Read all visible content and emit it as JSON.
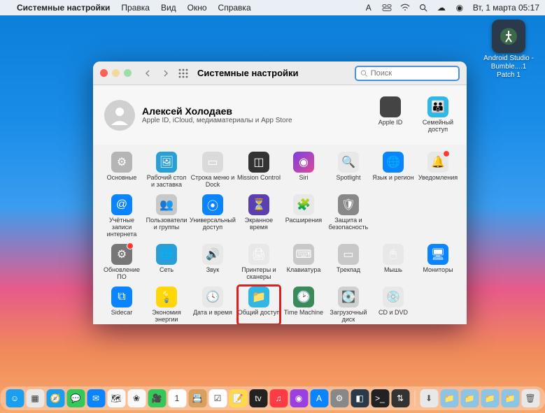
{
  "menubar": {
    "apple": "",
    "appname": "Системные настройки",
    "items": [
      "Правка",
      "Вид",
      "Окно",
      "Справка"
    ],
    "clock": "Вт, 1 марта  05:17"
  },
  "desktop_icon": {
    "label": "Android Studio - Bumble....1 Patch 1"
  },
  "window": {
    "title": "Системные настройки",
    "search_placeholder": "Поиск",
    "user": {
      "name": "Алексей Холодаев",
      "subtitle": "Apple ID, iCloud, медиаматериалы и App Store"
    },
    "right_items": [
      {
        "label": "Apple ID",
        "name": "apple-id",
        "color": "#444"
      },
      {
        "label": "Семейный доступ",
        "name": "family-sharing",
        "color": "#2fb8e6"
      }
    ],
    "prefs": [
      {
        "label": "Основные",
        "name": "general",
        "bg": "#b5b5b5",
        "glyph": "⚙"
      },
      {
        "label": "Рабочий стол и заставка",
        "name": "desktop-screensaver",
        "bg": "#2a9fd6",
        "glyph": "🖼"
      },
      {
        "label": "Строка меню и Dock",
        "name": "dock-menubar",
        "bg": "#dadada",
        "glyph": "▭"
      },
      {
        "label": "Mission Control",
        "name": "mission-control",
        "bg": "#333",
        "glyph": "◫"
      },
      {
        "label": "Siri",
        "name": "siri",
        "bg": "linear-gradient(135deg,#7a3fe0,#e04a9a)",
        "glyph": "◉"
      },
      {
        "label": "Spotlight",
        "name": "spotlight",
        "bg": "#e8e8e8",
        "glyph": "🔍"
      },
      {
        "label": "Язык и регион",
        "name": "language-region",
        "bg": "#0a84ff",
        "glyph": "🌐"
      },
      {
        "label": "Уведомления",
        "name": "notifications",
        "bg": "#e8e8e8",
        "glyph": "🔔",
        "badge": true
      },
      {
        "label": "Учётные записи интернета",
        "name": "internet-accounts",
        "bg": "#0a84ff",
        "glyph": "@"
      },
      {
        "label": "Пользователи и группы",
        "name": "users-groups",
        "bg": "#c8c8c8",
        "glyph": "👥"
      },
      {
        "label": "Универсальный доступ",
        "name": "accessibility",
        "bg": "#0a84ff",
        "glyph": "⦿"
      },
      {
        "label": "Экранное время",
        "name": "screen-time",
        "bg": "#5a3fb0",
        "glyph": "⏳"
      },
      {
        "label": "Расширения",
        "name": "extensions",
        "bg": "#e8e8e8",
        "glyph": "🧩"
      },
      {
        "label": "Защита и безопасность",
        "name": "security-privacy",
        "bg": "#888",
        "glyph": "🛡"
      },
      {
        "label": "",
        "name": "empty1",
        "bg": "transparent"
      },
      {
        "label": "",
        "name": "empty2",
        "bg": "transparent"
      },
      {
        "label": "Обновление ПО",
        "name": "software-update",
        "bg": "#777",
        "glyph": "⚙",
        "badge": true
      },
      {
        "label": "Сеть",
        "name": "network",
        "bg": "#2a9fd6",
        "glyph": "🌐"
      },
      {
        "label": "Звук",
        "name": "sound",
        "bg": "#e8e8e8",
        "glyph": "🔊"
      },
      {
        "label": "Принтеры и сканеры",
        "name": "printers-scanners",
        "bg": "#e8e8e8",
        "glyph": "🖨"
      },
      {
        "label": "Клавиатура",
        "name": "keyboard",
        "bg": "#c8c8c8",
        "glyph": "⌨"
      },
      {
        "label": "Трекпад",
        "name": "trackpad",
        "bg": "#c8c8c8",
        "glyph": "▭"
      },
      {
        "label": "Мышь",
        "name": "mouse",
        "bg": "#e8e8e8",
        "glyph": "🖱"
      },
      {
        "label": "Мониторы",
        "name": "displays",
        "bg": "#0a84ff",
        "glyph": "🖥"
      },
      {
        "label": "Sidecar",
        "name": "sidecar",
        "bg": "#0a84ff",
        "glyph": "⧉"
      },
      {
        "label": "Экономия энергии",
        "name": "energy-saver",
        "bg": "#ffd60a",
        "glyph": "💡"
      },
      {
        "label": "Дата и время",
        "name": "date-time",
        "bg": "#e8e8e8",
        "glyph": "🕓"
      },
      {
        "label": "Общий доступ",
        "name": "sharing",
        "bg": "#2fb8e6",
        "glyph": "📁",
        "highlight": true
      },
      {
        "label": "Time Machine",
        "name": "time-machine",
        "bg": "#3a8a5a",
        "glyph": "🕑"
      },
      {
        "label": "Загрузочный диск",
        "name": "startup-disk",
        "bg": "#d0d0d0",
        "glyph": "💽"
      },
      {
        "label": "CD и DVD",
        "name": "cd-dvd",
        "bg": "#e8e8e8",
        "glyph": "💿"
      },
      {
        "label": "",
        "name": "empty3",
        "bg": "transparent"
      }
    ]
  },
  "dock": {
    "items": [
      {
        "name": "finder",
        "bg": "#1a9ff0",
        "glyph": "☺"
      },
      {
        "name": "launchpad",
        "bg": "#e8e8e8",
        "glyph": "▦"
      },
      {
        "name": "safari",
        "bg": "#1a9ff0",
        "glyph": "🧭"
      },
      {
        "name": "messages",
        "bg": "#34c759",
        "glyph": "💬"
      },
      {
        "name": "mail",
        "bg": "#0a84ff",
        "glyph": "✉"
      },
      {
        "name": "maps",
        "bg": "#f8f8f8",
        "glyph": "🗺"
      },
      {
        "name": "photos",
        "bg": "#f8f8f8",
        "glyph": "❀"
      },
      {
        "name": "facetime",
        "bg": "#34c759",
        "glyph": "🎥"
      },
      {
        "name": "calendar",
        "bg": "#fff",
        "glyph": "1"
      },
      {
        "name": "contacts",
        "bg": "#d8a060",
        "glyph": "📇"
      },
      {
        "name": "reminders",
        "bg": "#fff",
        "glyph": "☑"
      },
      {
        "name": "notes",
        "bg": "#ffd94a",
        "glyph": "📝"
      },
      {
        "name": "tv",
        "bg": "#222",
        "glyph": "tv"
      },
      {
        "name": "music",
        "bg": "#fc3c44",
        "glyph": "♫"
      },
      {
        "name": "podcasts",
        "bg": "#9a3fe0",
        "glyph": "◉"
      },
      {
        "name": "appstore",
        "bg": "#0a84ff",
        "glyph": "A"
      },
      {
        "name": "system-preferences",
        "bg": "#888",
        "glyph": "⚙"
      },
      {
        "name": "android-studio",
        "bg": "#2a3a4a",
        "glyph": "◧"
      },
      {
        "name": "terminal",
        "bg": "#222",
        "glyph": ">_"
      },
      {
        "name": "transmit",
        "bg": "#333",
        "glyph": "⇅"
      }
    ],
    "right": [
      {
        "name": "downloads",
        "bg": "#e8e8e8",
        "glyph": "⬇"
      },
      {
        "name": "folder1",
        "bg": "#8ac5e8",
        "glyph": "📁"
      },
      {
        "name": "folder2",
        "bg": "#8ac5e8",
        "glyph": "📁"
      },
      {
        "name": "folder3",
        "bg": "#8ac5e8",
        "glyph": "📁"
      },
      {
        "name": "folder4",
        "bg": "#8ac5e8",
        "glyph": "📁"
      },
      {
        "name": "trash",
        "bg": "#e8e8e8",
        "glyph": "🗑"
      }
    ]
  }
}
